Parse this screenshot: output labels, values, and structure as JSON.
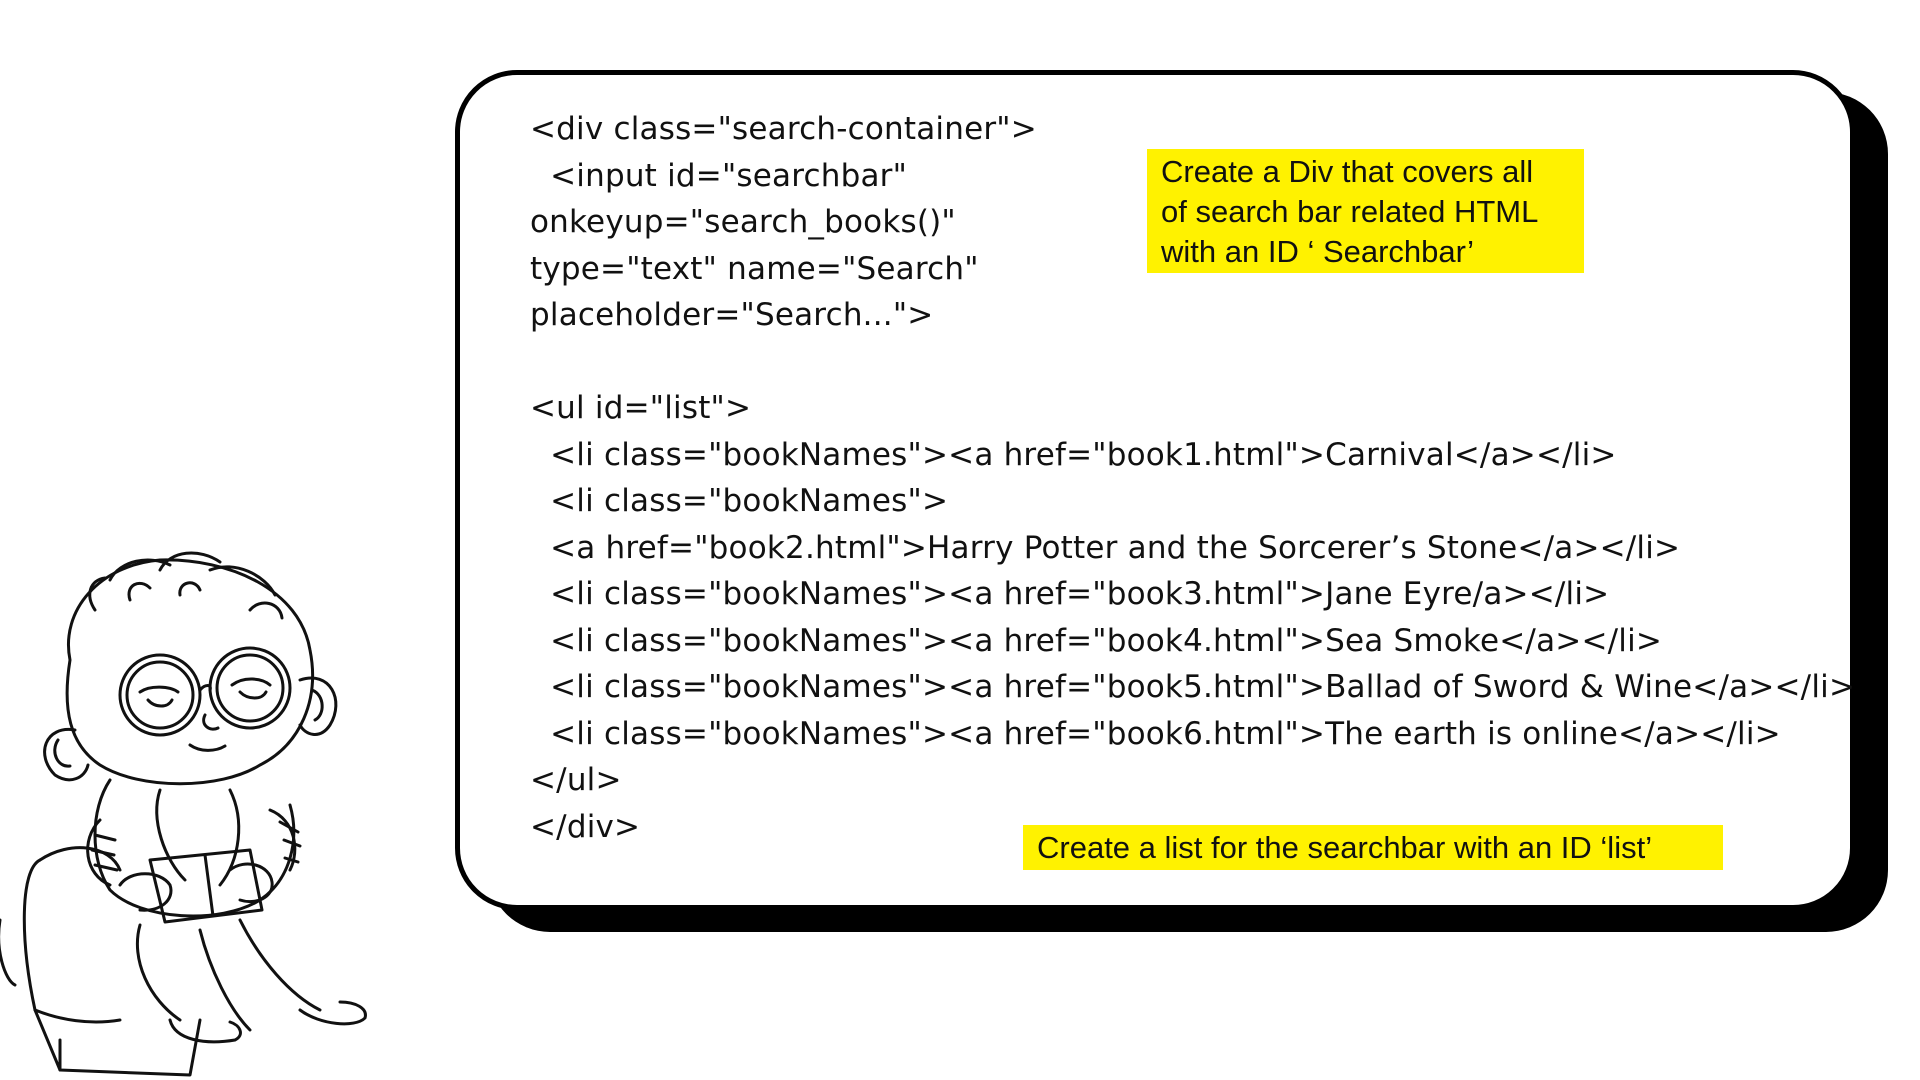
{
  "code": {
    "lines": [
      "<div class=\"search-container\">",
      "  <input id=\"searchbar\"",
      "onkeyup=\"search_books()\"",
      "type=\"text\" name=\"Search\"",
      "placeholder=\"Search...\">",
      "",
      "<ul id=\"list\">",
      "  <li class=\"bookNames\"><a href=\"book1.html\">Carnival</a></li>",
      "  <li class=\"bookNames\">",
      "  <a href=\"book2.html\">Harry Potter and the Sorcerer’s Stone</a></li>",
      "  <li class=\"bookNames\"><a href=\"book3.html\">Jane Eyre/a></li>",
      "  <li class=\"bookNames\"><a href=\"book4.html\">Sea Smoke</a></li>",
      "  <li class=\"bookNames\"><a href=\"book5.html\">Ballad of Sword & Wine</a></li>",
      "  <li class=\"bookNames\"><a href=\"book6.html\">The earth is online</a></li>",
      "</ul>",
      "</div>"
    ]
  },
  "notes": {
    "div_note": {
      "lines": [
        "Create a Div that covers all",
        "of search bar related HTML",
        "with an ID ‘ Searchbar’"
      ]
    },
    "list_note": "Create a list for the searchbar with an ID ‘list’"
  },
  "colors": {
    "highlight": "#fff200",
    "ink": "#111111",
    "card_shadow": "#000000"
  },
  "illustration": "cartoon-child-with-glasses-sitting-in-armchair"
}
